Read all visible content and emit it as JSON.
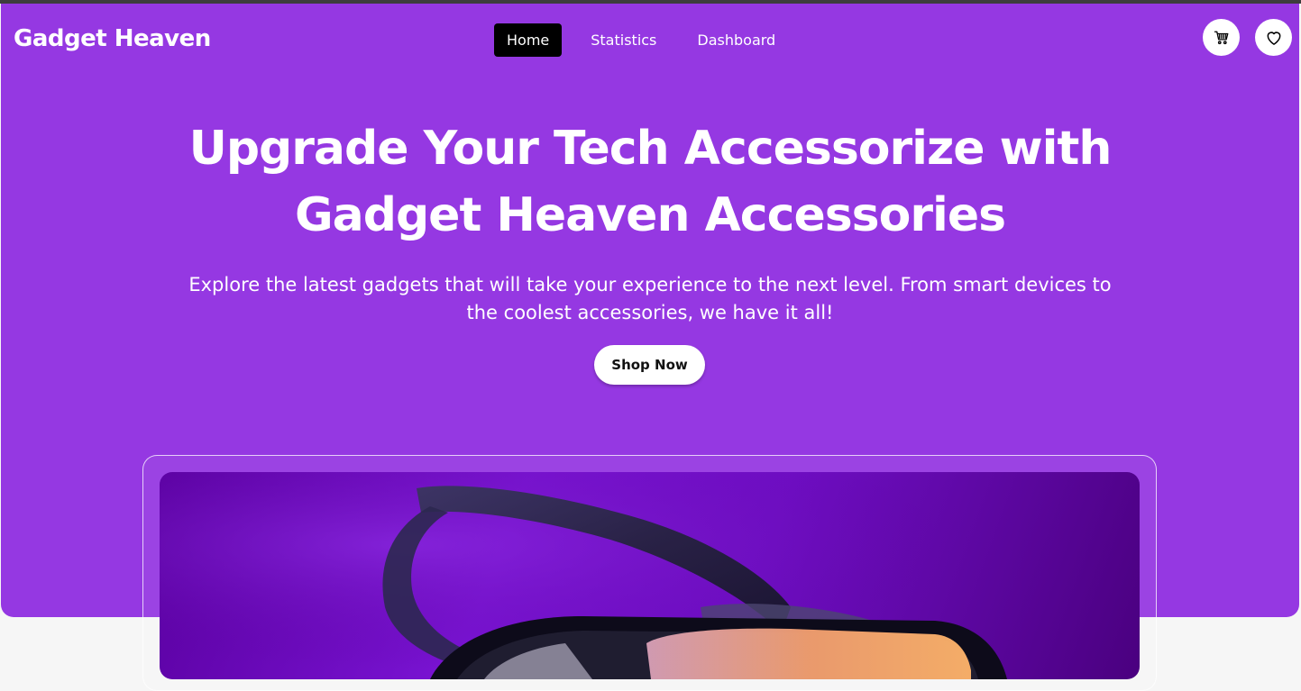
{
  "header": {
    "brand": "Gadget Heaven",
    "nav": [
      {
        "label": "Home",
        "active": true
      },
      {
        "label": "Statistics",
        "active": false
      },
      {
        "label": "Dashboard",
        "active": false
      }
    ],
    "icons": {
      "cart": "cart-icon",
      "wishlist": "heart-icon"
    }
  },
  "hero": {
    "headline_line1": "Upgrade Your Tech Accessorize with",
    "headline_line2": "Gadget Heaven Accessories",
    "subtext_line1": "Explore the latest gadgets that will take your experience to the next level. From smart devices to",
    "subtext_line2": "the coolest accessories, we have it all!",
    "cta_label": "Shop Now"
  },
  "banner": {
    "image": "vr-headset-image"
  },
  "colors": {
    "hero_bg": "#9538e2",
    "active_nav_bg": "#000000",
    "text": "#ffffff"
  }
}
